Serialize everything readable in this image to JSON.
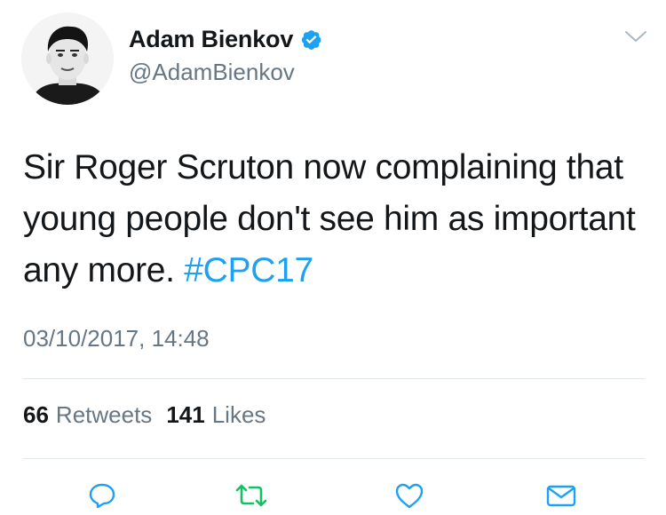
{
  "author": {
    "display_name": "Adam Bienkov",
    "handle": "@AdamBienkov",
    "verified": true
  },
  "tweet": {
    "text": "Sir Roger Scruton now complaining that young people don't see him as important any more. ",
    "hashtag": "#CPC17",
    "timestamp": "03/10/2017, 14:48"
  },
  "stats": {
    "retweets_count": "66",
    "retweets_label": "Retweets",
    "likes_count": "141",
    "likes_label": "Likes"
  },
  "colors": {
    "link": "#1da1f2",
    "retweet_icon": "#17bf63",
    "secondary_text": "#657786",
    "primary_text": "#14171a",
    "divider": "#e1e8ed"
  },
  "icons": {
    "verified": "verified-badge-icon",
    "caret": "chevron-down-icon",
    "reply": "reply-icon",
    "retweet": "retweet-icon",
    "like": "heart-icon",
    "dm": "envelope-icon"
  }
}
